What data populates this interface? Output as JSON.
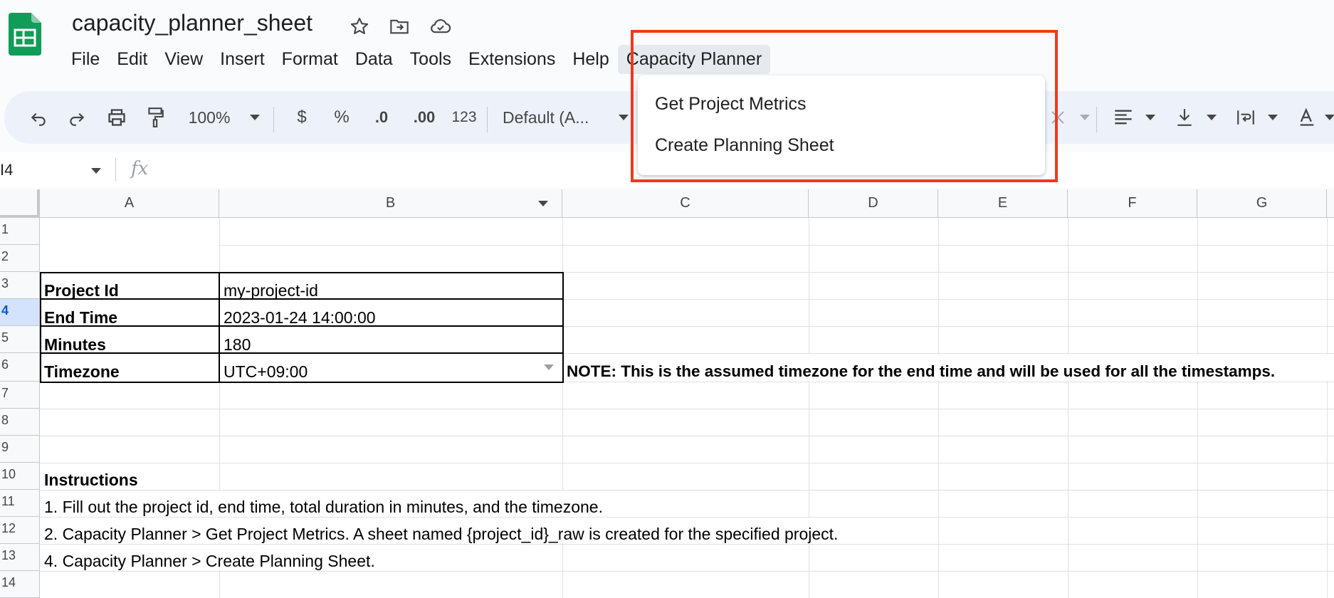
{
  "app": {
    "title": "capacity_planner_sheet",
    "brand_color": "#0f9d58"
  },
  "menu": {
    "items": [
      "File",
      "Edit",
      "View",
      "Insert",
      "Format",
      "Data",
      "Tools",
      "Extensions",
      "Help",
      "Capacity Planner"
    ],
    "active": "Capacity Planner"
  },
  "dropdown": {
    "items": [
      "Get Project Metrics",
      "Create Planning Sheet"
    ],
    "highlight_color": "#ee3a1c"
  },
  "toolbar": {
    "zoom": "100%",
    "currency": "$",
    "percent": "%",
    "decrease_decimal": ".0",
    "increase_decimal": ".00",
    "number_format": "123",
    "font": "Default (A...",
    "icons": [
      "undo-icon",
      "redo-icon",
      "print-icon",
      "paint-format-icon",
      "align-left-icon",
      "vertical-align-icon",
      "text-wrap-icon",
      "text-rotation-icon"
    ]
  },
  "formula_bar": {
    "name_box": "I4",
    "fx_label": "fx"
  },
  "sheet": {
    "columns": [
      "A",
      "B",
      "C",
      "D",
      "E",
      "F",
      "G"
    ],
    "rows": [
      "1",
      "2",
      "3",
      "4",
      "5",
      "6",
      "7",
      "8",
      "9",
      "10",
      "11",
      "12",
      "13",
      "14"
    ],
    "selected_row": "4",
    "cells": {
      "A3": "Project Id",
      "B3": "my-project-id",
      "A4": "End Time",
      "B4": "2023-01-24 14:00:00",
      "A5": "Minutes",
      "B5": "180",
      "A6": "Timezone",
      "B6": "UTC+09:00",
      "C6": "NOTE: This is the assumed timezone for the end time and will be used for all the timestamps.",
      "A10": "Instructions",
      "A11": "1. Fill out the project id, end time, total duration in minutes, and the timezone.",
      "A12": "2. Capacity Planner > Get Project Metrics. A sheet named {project_id}_raw is created for the specified project.",
      "A13": "4. Capacity Planner > Create Planning Sheet."
    }
  }
}
